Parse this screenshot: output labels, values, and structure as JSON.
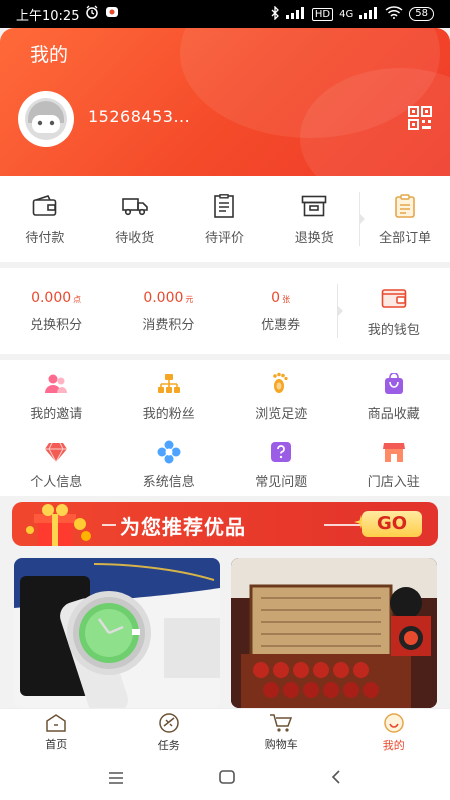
{
  "status": {
    "time": "上午10:25",
    "network": "4G",
    "hd": "HD",
    "battery": "58"
  },
  "header": {
    "title": "我的",
    "user_phone": "15268453..."
  },
  "orders": {
    "items": [
      {
        "label": "待付款",
        "icon": "wallet-icon"
      },
      {
        "label": "待收货",
        "icon": "truck-icon"
      },
      {
        "label": "待评价",
        "icon": "review-icon"
      },
      {
        "label": "退换货",
        "icon": "return-box-icon"
      }
    ],
    "all_label": "全部订单"
  },
  "points": {
    "items": [
      {
        "value": "0.000",
        "unit": "点",
        "label": "兑换积分"
      },
      {
        "value": "0.000",
        "unit": "元",
        "label": "消费积分"
      },
      {
        "value": "0",
        "unit": "张",
        "label": "优惠券"
      }
    ],
    "wallet_label": "我的钱包"
  },
  "services": {
    "rows": [
      [
        {
          "label": "我的邀请",
          "icon": "invite-users-icon"
        },
        {
          "label": "我的粉丝",
          "icon": "fans-tree-icon"
        },
        {
          "label": "浏览足迹",
          "icon": "footprint-icon"
        },
        {
          "label": "商品收藏",
          "icon": "shopping-bag-icon"
        }
      ],
      [
        {
          "label": "个人信息",
          "icon": "diamond-icon"
        },
        {
          "label": "系统信息",
          "icon": "flower-icon"
        },
        {
          "label": "常见问题",
          "icon": "question-icon"
        },
        {
          "label": "门店入驻",
          "icon": "store-icon"
        }
      ]
    ]
  },
  "banner": {
    "text": "为您推荐优品",
    "go": "GO"
  },
  "tabbar": {
    "items": [
      {
        "label": "首页",
        "icon": "home-icon"
      },
      {
        "label": "任务",
        "icon": "task-icon"
      },
      {
        "label": "购物车",
        "icon": "cart-icon"
      },
      {
        "label": "我的",
        "icon": "profile-icon"
      }
    ],
    "active": "我的"
  },
  "colors": {
    "brand": "#f04a2e",
    "accent_text": "#e8492d",
    "icon_brown": "#6b5236"
  }
}
